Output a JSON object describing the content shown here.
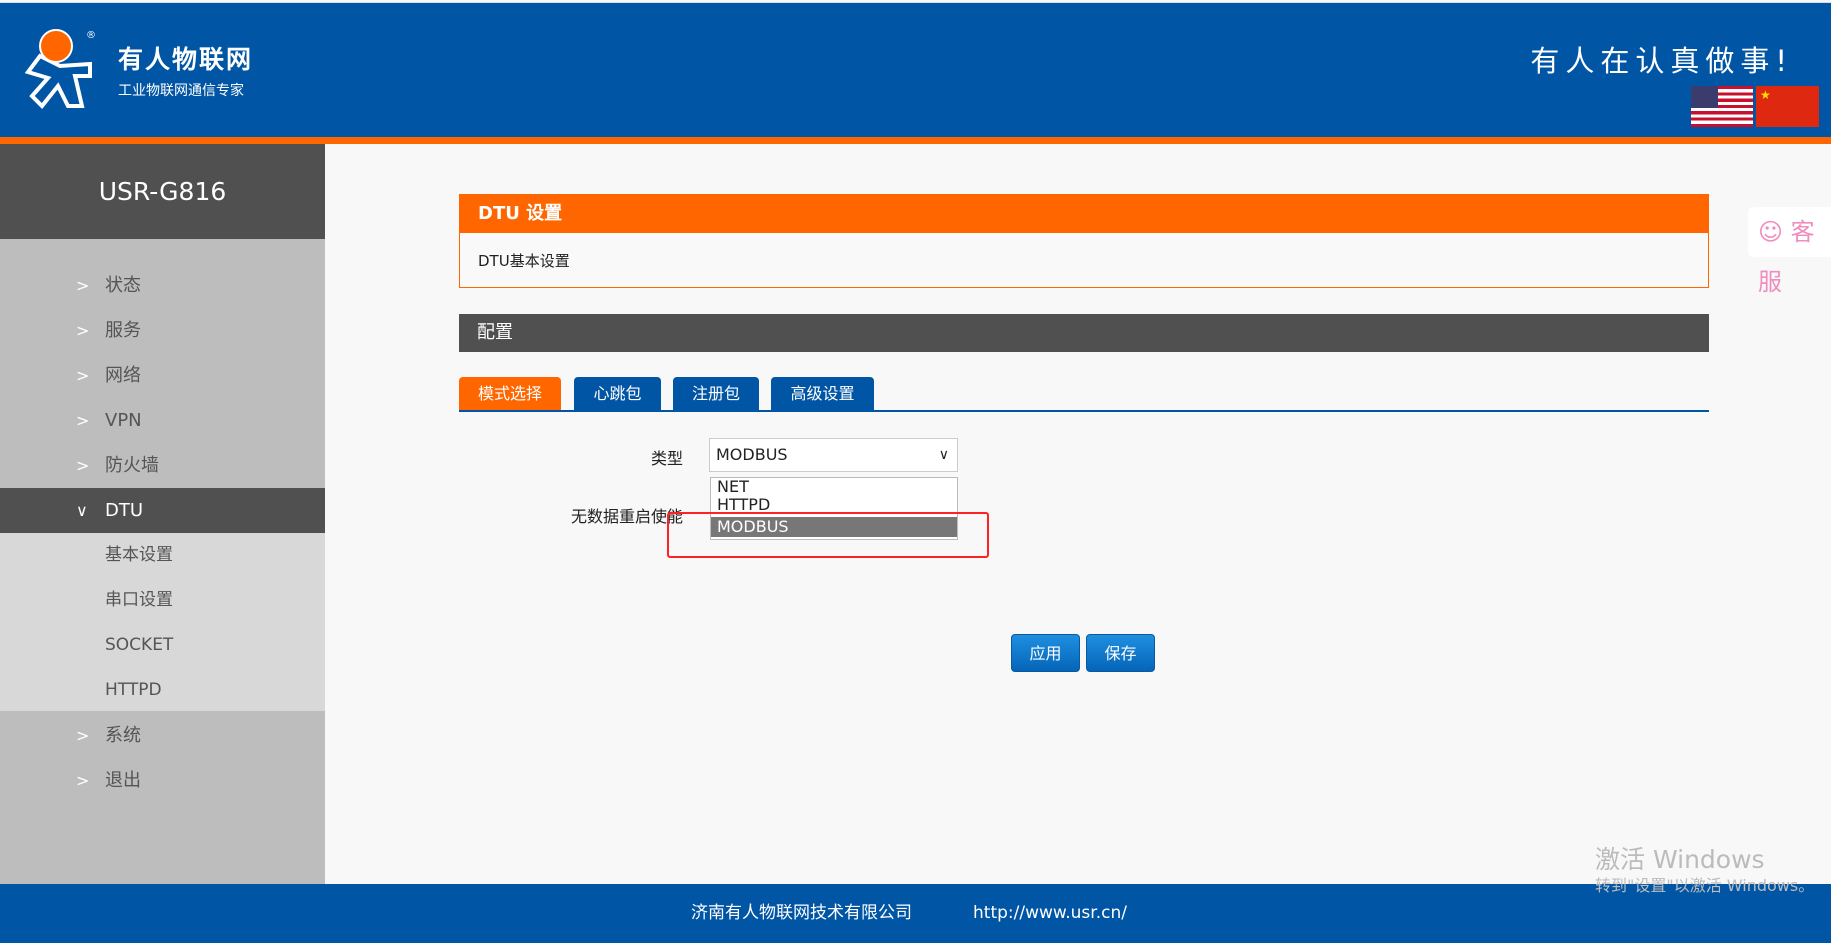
{
  "header": {
    "brand_name": "有人物联网",
    "brand_sub": "工业物联网通信专家",
    "slogan": "有人在认真做事!",
    "lang_en": "English",
    "lang_cn": "中文"
  },
  "sidebar": {
    "title": "USR-G816",
    "items": [
      {
        "label": "状态"
      },
      {
        "label": "服务"
      },
      {
        "label": "网络"
      },
      {
        "label": "VPN"
      },
      {
        "label": "防火墙"
      },
      {
        "label": "DTU"
      }
    ],
    "dtu_sub": [
      {
        "label": "基本设置"
      },
      {
        "label": "串口设置"
      },
      {
        "label": "SOCKET"
      },
      {
        "label": "HTTPD"
      }
    ],
    "bottom": [
      {
        "label": "系统"
      },
      {
        "label": "退出"
      }
    ]
  },
  "panel": {
    "title": "DTU 设置",
    "subtitle": "DTU基本设置"
  },
  "config": {
    "title": "配置",
    "tabs": [
      {
        "label": "模式选择"
      },
      {
        "label": "心跳包"
      },
      {
        "label": "注册包"
      },
      {
        "label": "高级设置"
      }
    ]
  },
  "form": {
    "type_label": "类型",
    "type_value": "MODBUS",
    "options": [
      "NET",
      "HTTPD",
      "MODBUS"
    ],
    "restart_label": "无数据重启使能"
  },
  "buttons": {
    "apply": "应用",
    "save": "保存"
  },
  "kefu": {
    "label": "客服"
  },
  "footer": {
    "company": "济南有人物联网技术有限公司",
    "url": "http://www.usr.cn/"
  },
  "watermark": {
    "line1": "激活 Windows",
    "line2": "转到\"设置\"以激活 Windows。"
  },
  "colors": {
    "blue": "#0055a5",
    "orange": "#ff6600"
  }
}
